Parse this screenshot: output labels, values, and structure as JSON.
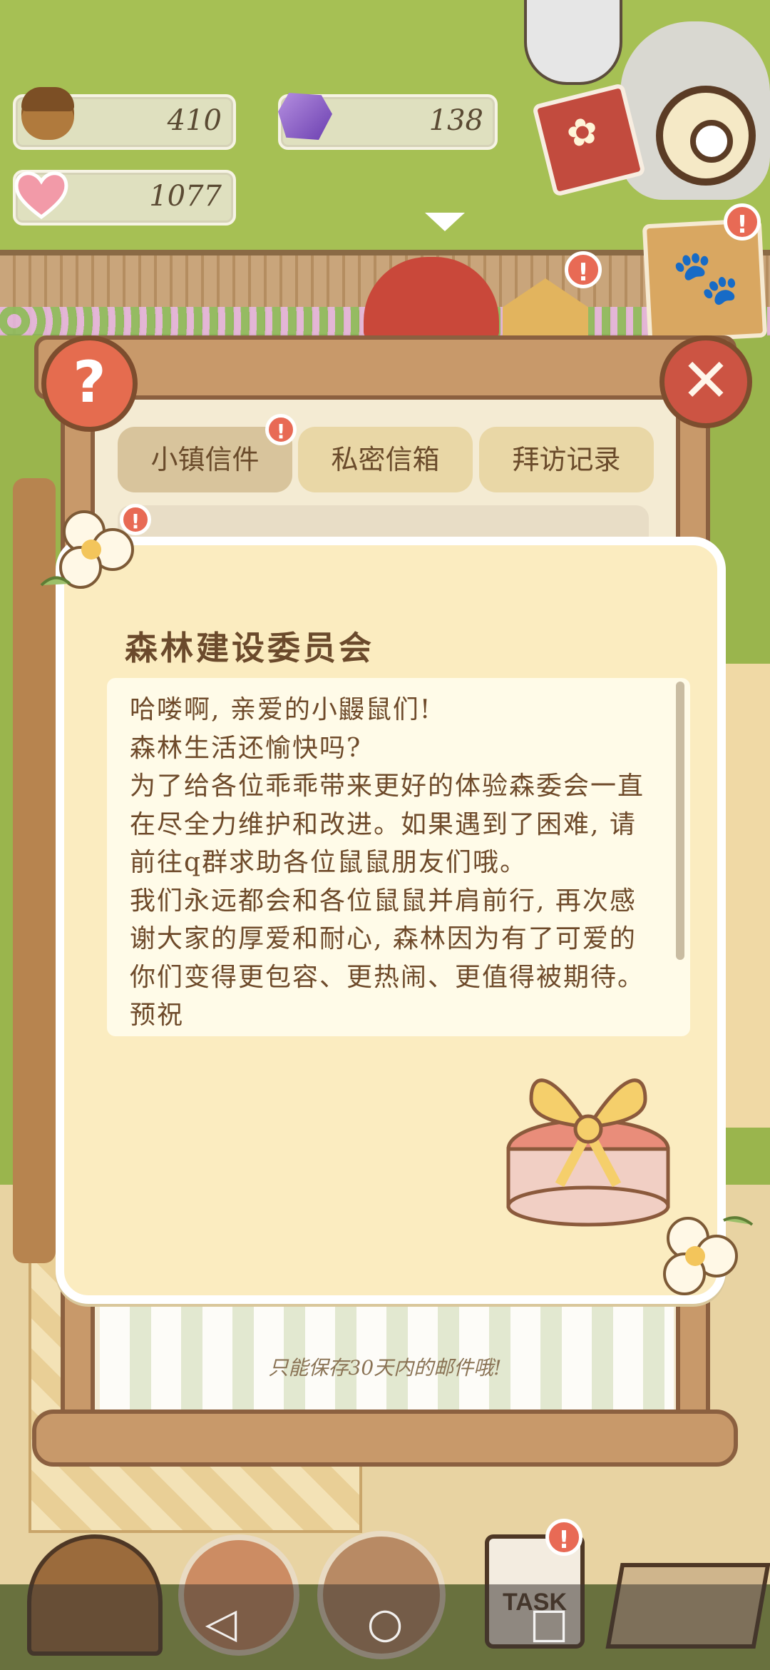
{
  "resources": {
    "acorns": "410",
    "gems": "138",
    "hearts": "1077"
  },
  "header": {
    "notification_badge": "!"
  },
  "mail": {
    "help_label": "?",
    "close_label": "✕",
    "tabs": [
      {
        "label": "小镇信件",
        "active": true,
        "badge": "!"
      },
      {
        "label": "私密信箱",
        "active": false
      },
      {
        "label": "拜访记录",
        "active": false
      }
    ],
    "list_badge": "!",
    "keep_note": "只能保存30天内的邮件哦!"
  },
  "letter": {
    "sender": "森林建设委员会",
    "body": "哈喽啊, 亲爱的小鼹鼠们!\n森林生活还愉快吗?\n为了给各位乖乖带来更好的体验森委会一直在尽全力维护和改进。如果遇到了困难, 请前往q群求助各位鼠鼠朋友们哦。\n我们永远都会和各位鼠鼠并肩前行, 再次感谢大家的厚爱和耐心, 森林因为有了可爱的你们变得更包容、更热闹、更值得被期待。预祝"
  },
  "bottom": {
    "task_label": "TASK",
    "task_badge": "!",
    "nav_back": "◁",
    "nav_home": "○",
    "nav_recent": "□"
  },
  "colors": {
    "accent_red": "#e86a55",
    "wood": "#c8996a",
    "paper": "#fbecc0",
    "text_brown": "#6b4a2c"
  }
}
